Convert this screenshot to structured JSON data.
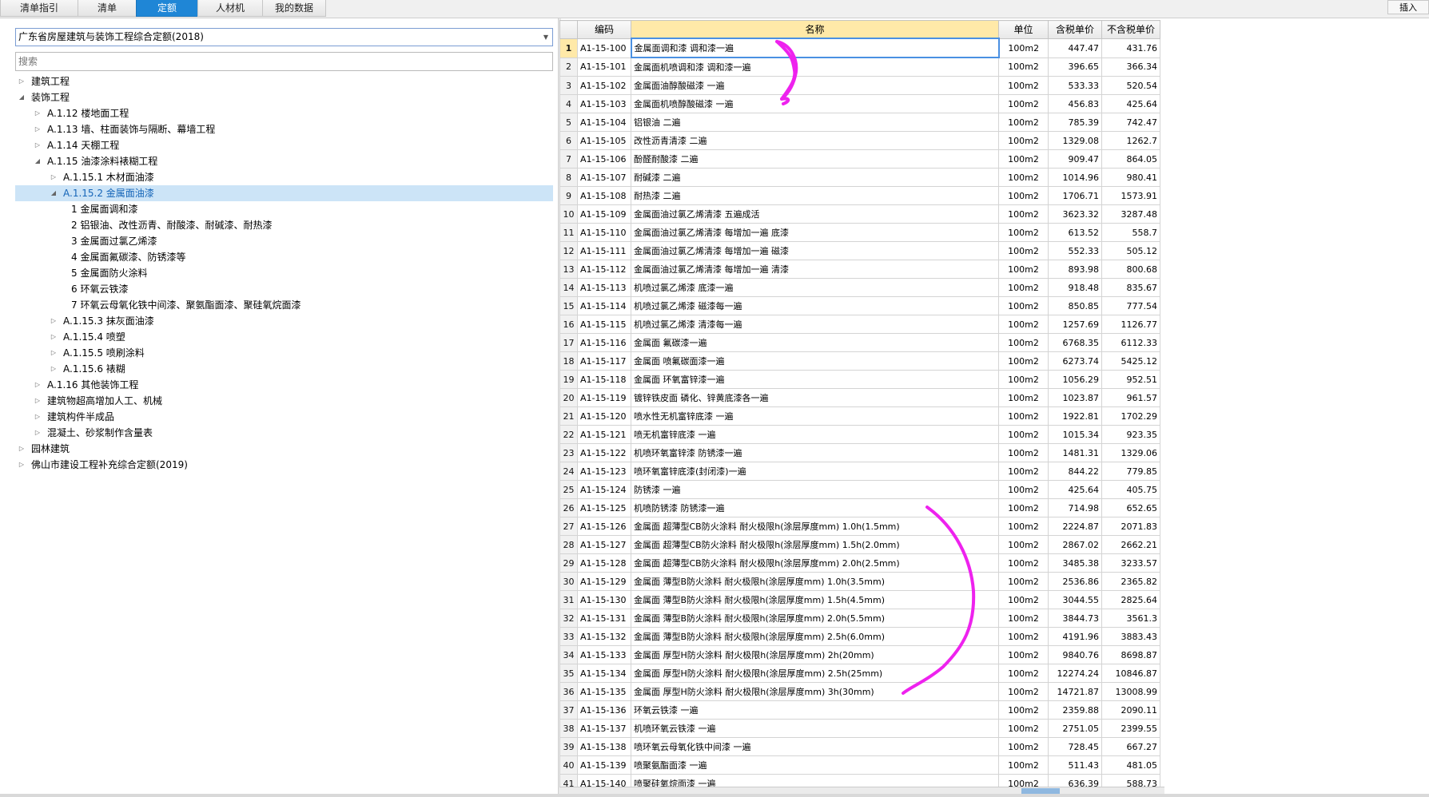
{
  "tabs": [
    "清单指引",
    "清单",
    "定额",
    "人材机",
    "我的数据"
  ],
  "active_tab": 2,
  "insert_label": "插入",
  "quota_library": "广东省房屋建筑与装饰工程综合定额(2018)",
  "search_placeholder": "搜索",
  "tree": [
    {
      "label": "建筑工程",
      "indent": 0,
      "state": "collapsed"
    },
    {
      "label": "装饰工程",
      "indent": 0,
      "state": "expanded"
    },
    {
      "label": "A.1.12 楼地面工程",
      "indent": 1,
      "state": "collapsed"
    },
    {
      "label": "A.1.13 墙、柱面装饰与隔断、幕墙工程",
      "indent": 1,
      "state": "collapsed"
    },
    {
      "label": "A.1.14 天棚工程",
      "indent": 1,
      "state": "collapsed"
    },
    {
      "label": "A.1.15 油漆涂料裱糊工程",
      "indent": 1,
      "state": "expanded"
    },
    {
      "label": "A.1.15.1 木材面油漆",
      "indent": 2,
      "state": "collapsed"
    },
    {
      "label": "A.1.15.2 金属面油漆",
      "indent": 2,
      "state": "expanded",
      "selected": true
    },
    {
      "label": "1 金属面调和漆",
      "indent": 3,
      "state": "leaf"
    },
    {
      "label": "2 铝银油、改性沥青、耐酸漆、耐碱漆、耐热漆",
      "indent": 3,
      "state": "leaf"
    },
    {
      "label": "3 金属面过氯乙烯漆",
      "indent": 3,
      "state": "leaf"
    },
    {
      "label": "4 金属面氟碳漆、防锈漆等",
      "indent": 3,
      "state": "leaf"
    },
    {
      "label": "5 金属面防火涂料",
      "indent": 3,
      "state": "leaf"
    },
    {
      "label": "6 环氧云铁漆",
      "indent": 3,
      "state": "leaf"
    },
    {
      "label": "7 环氧云母氧化铁中间漆、聚氨酯面漆、聚硅氧烷面漆",
      "indent": 3,
      "state": "leaf"
    },
    {
      "label": "A.1.15.3 抹灰面油漆",
      "indent": 2,
      "state": "collapsed"
    },
    {
      "label": "A.1.15.4 喷塑",
      "indent": 2,
      "state": "collapsed"
    },
    {
      "label": "A.1.15.5 喷刷涂料",
      "indent": 2,
      "state": "collapsed"
    },
    {
      "label": "A.1.15.6 裱糊",
      "indent": 2,
      "state": "collapsed"
    },
    {
      "label": "A.1.16 其他装饰工程",
      "indent": 1,
      "state": "collapsed"
    },
    {
      "label": "建筑物超高增加人工、机械",
      "indent": 1,
      "state": "collapsed"
    },
    {
      "label": "建筑构件半成品",
      "indent": 1,
      "state": "collapsed"
    },
    {
      "label": "混凝土、砂浆制作含量表",
      "indent": 1,
      "state": "collapsed"
    },
    {
      "label": "园林建筑",
      "indent": 0,
      "state": "collapsed"
    },
    {
      "label": "佛山市建设工程补充综合定额(2019)",
      "indent": 0,
      "state": "collapsed"
    }
  ],
  "columns": {
    "no": "",
    "code": "编码",
    "name": "名称",
    "unit": "单位",
    "price_tax": "含税单价",
    "price_notax": "不含税单价"
  },
  "rows": [
    [
      "1",
      "A1-15-100",
      "金属面调和漆 调和漆一遍",
      "100m2",
      "447.47",
      "431.76"
    ],
    [
      "2",
      "A1-15-101",
      "金属面机喷调和漆 调和漆一遍",
      "100m2",
      "396.65",
      "366.34"
    ],
    [
      "3",
      "A1-15-102",
      "金属面油醇酸磁漆 一遍",
      "100m2",
      "533.33",
      "520.54"
    ],
    [
      "4",
      "A1-15-103",
      "金属面机喷醇酸磁漆 一遍",
      "100m2",
      "456.83",
      "425.64"
    ],
    [
      "5",
      "A1-15-104",
      "铝银油 二遍",
      "100m2",
      "785.39",
      "742.47"
    ],
    [
      "6",
      "A1-15-105",
      "改性沥青清漆 二遍",
      "100m2",
      "1329.08",
      "1262.7"
    ],
    [
      "7",
      "A1-15-106",
      "酚醛耐酸漆 二遍",
      "100m2",
      "909.47",
      "864.05"
    ],
    [
      "8",
      "A1-15-107",
      "耐碱漆 二遍",
      "100m2",
      "1014.96",
      "980.41"
    ],
    [
      "9",
      "A1-15-108",
      "耐热漆 二遍",
      "100m2",
      "1706.71",
      "1573.91"
    ],
    [
      "10",
      "A1-15-109",
      "金属面油过氯乙烯清漆 五遍成活",
      "100m2",
      "3623.32",
      "3287.48"
    ],
    [
      "11",
      "A1-15-110",
      "金属面油过氯乙烯清漆 每增加一遍 底漆",
      "100m2",
      "613.52",
      "558.7"
    ],
    [
      "12",
      "A1-15-111",
      "金属面油过氯乙烯清漆 每增加一遍 磁漆",
      "100m2",
      "552.33",
      "505.12"
    ],
    [
      "13",
      "A1-15-112",
      "金属面油过氯乙烯清漆 每增加一遍 清漆",
      "100m2",
      "893.98",
      "800.68"
    ],
    [
      "14",
      "A1-15-113",
      "机喷过氯乙烯漆 底漆一遍",
      "100m2",
      "918.48",
      "835.67"
    ],
    [
      "15",
      "A1-15-114",
      "机喷过氯乙烯漆 磁漆每一遍",
      "100m2",
      "850.85",
      "777.54"
    ],
    [
      "16",
      "A1-15-115",
      "机喷过氯乙烯漆 清漆每一遍",
      "100m2",
      "1257.69",
      "1126.77"
    ],
    [
      "17",
      "A1-15-116",
      "金属面 氟碳漆一遍",
      "100m2",
      "6768.35",
      "6112.33"
    ],
    [
      "18",
      "A1-15-117",
      "金属面 喷氟碳面漆一遍",
      "100m2",
      "6273.74",
      "5425.12"
    ],
    [
      "19",
      "A1-15-118",
      "金属面 环氧富锌漆一遍",
      "100m2",
      "1056.29",
      "952.51"
    ],
    [
      "20",
      "A1-15-119",
      "镀锌铁皮面 磷化、锌黄底漆各一遍",
      "100m2",
      "1023.87",
      "961.57"
    ],
    [
      "21",
      "A1-15-120",
      "喷水性无机富锌底漆 一遍",
      "100m2",
      "1922.81",
      "1702.29"
    ],
    [
      "22",
      "A1-15-121",
      "喷无机富锌底漆 一遍",
      "100m2",
      "1015.34",
      "923.35"
    ],
    [
      "23",
      "A1-15-122",
      "机喷环氧富锌漆 防锈漆一遍",
      "100m2",
      "1481.31",
      "1329.06"
    ],
    [
      "24",
      "A1-15-123",
      "喷环氧富锌底漆(封闭漆)一遍",
      "100m2",
      "844.22",
      "779.85"
    ],
    [
      "25",
      "A1-15-124",
      "防锈漆 一遍",
      "100m2",
      "425.64",
      "405.75"
    ],
    [
      "26",
      "A1-15-125",
      "机喷防锈漆 防锈漆一遍",
      "100m2",
      "714.98",
      "652.65"
    ],
    [
      "27",
      "A1-15-126",
      "金属面 超薄型CB防火涂料 耐火极限h(涂层厚度mm) 1.0h(1.5mm)",
      "100m2",
      "2224.87",
      "2071.83"
    ],
    [
      "28",
      "A1-15-127",
      "金属面 超薄型CB防火涂料 耐火极限h(涂层厚度mm) 1.5h(2.0mm)",
      "100m2",
      "2867.02",
      "2662.21"
    ],
    [
      "29",
      "A1-15-128",
      "金属面 超薄型CB防火涂料 耐火极限h(涂层厚度mm) 2.0h(2.5mm)",
      "100m2",
      "3485.38",
      "3233.57"
    ],
    [
      "30",
      "A1-15-129",
      "金属面 薄型B防火涂料 耐火极限h(涂层厚度mm) 1.0h(3.5mm)",
      "100m2",
      "2536.86",
      "2365.82"
    ],
    [
      "31",
      "A1-15-130",
      "金属面 薄型B防火涂料 耐火极限h(涂层厚度mm) 1.5h(4.5mm)",
      "100m2",
      "3044.55",
      "2825.64"
    ],
    [
      "32",
      "A1-15-131",
      "金属面 薄型B防火涂料 耐火极限h(涂层厚度mm) 2.0h(5.5mm)",
      "100m2",
      "3844.73",
      "3561.3"
    ],
    [
      "33",
      "A1-15-132",
      "金属面 薄型B防火涂料 耐火极限h(涂层厚度mm) 2.5h(6.0mm)",
      "100m2",
      "4191.96",
      "3883.43"
    ],
    [
      "34",
      "A1-15-133",
      "金属面 厚型H防火涂料 耐火极限h(涂层厚度mm) 2h(20mm)",
      "100m2",
      "9840.76",
      "8698.87"
    ],
    [
      "35",
      "A1-15-134",
      "金属面 厚型H防火涂料 耐火极限h(涂层厚度mm) 2.5h(25mm)",
      "100m2",
      "12274.24",
      "10846.87"
    ],
    [
      "36",
      "A1-15-135",
      "金属面 厚型H防火涂料 耐火极限h(涂层厚度mm) 3h(30mm)",
      "100m2",
      "14721.87",
      "13008.99"
    ],
    [
      "37",
      "A1-15-136",
      "环氧云铁漆 一遍",
      "100m2",
      "2359.88",
      "2090.11"
    ],
    [
      "38",
      "A1-15-137",
      "机喷环氧云铁漆 一遍",
      "100m2",
      "2751.05",
      "2399.55"
    ],
    [
      "39",
      "A1-15-138",
      "喷环氧云母氧化铁中间漆 一遍",
      "100m2",
      "728.45",
      "667.27"
    ],
    [
      "40",
      "A1-15-139",
      "喷聚氨酯面漆 一遍",
      "100m2",
      "511.43",
      "481.05"
    ],
    [
      "41",
      "A1-15-140",
      "喷聚硅氧烷面漆 一遍",
      "100m2",
      "636.39",
      "588.73"
    ]
  ],
  "annotation_color": "#ee22ee"
}
